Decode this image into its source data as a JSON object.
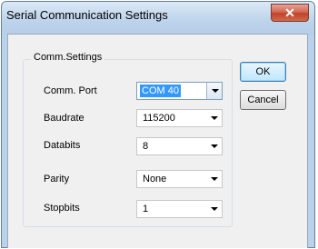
{
  "window": {
    "title": "Serial Communication Settings",
    "close_glyph": "✕"
  },
  "group": {
    "label": "Comm.Settings"
  },
  "fields": [
    {
      "label": "Comm. Port",
      "value": "COM 40"
    },
    {
      "label": "Baudrate",
      "value": "115200"
    },
    {
      "label": "Databits",
      "value": "8"
    },
    {
      "label": "Parity",
      "value": "None"
    },
    {
      "label": "Stopbits",
      "value": "1"
    }
  ],
  "buttons": {
    "ok": "OK",
    "cancel": "Cancel"
  },
  "colors": {
    "selection": "#3399ff",
    "close_button": "#c2422a"
  },
  "icons": {
    "close": "close-icon",
    "dropdown": "chevron-down-icon"
  }
}
